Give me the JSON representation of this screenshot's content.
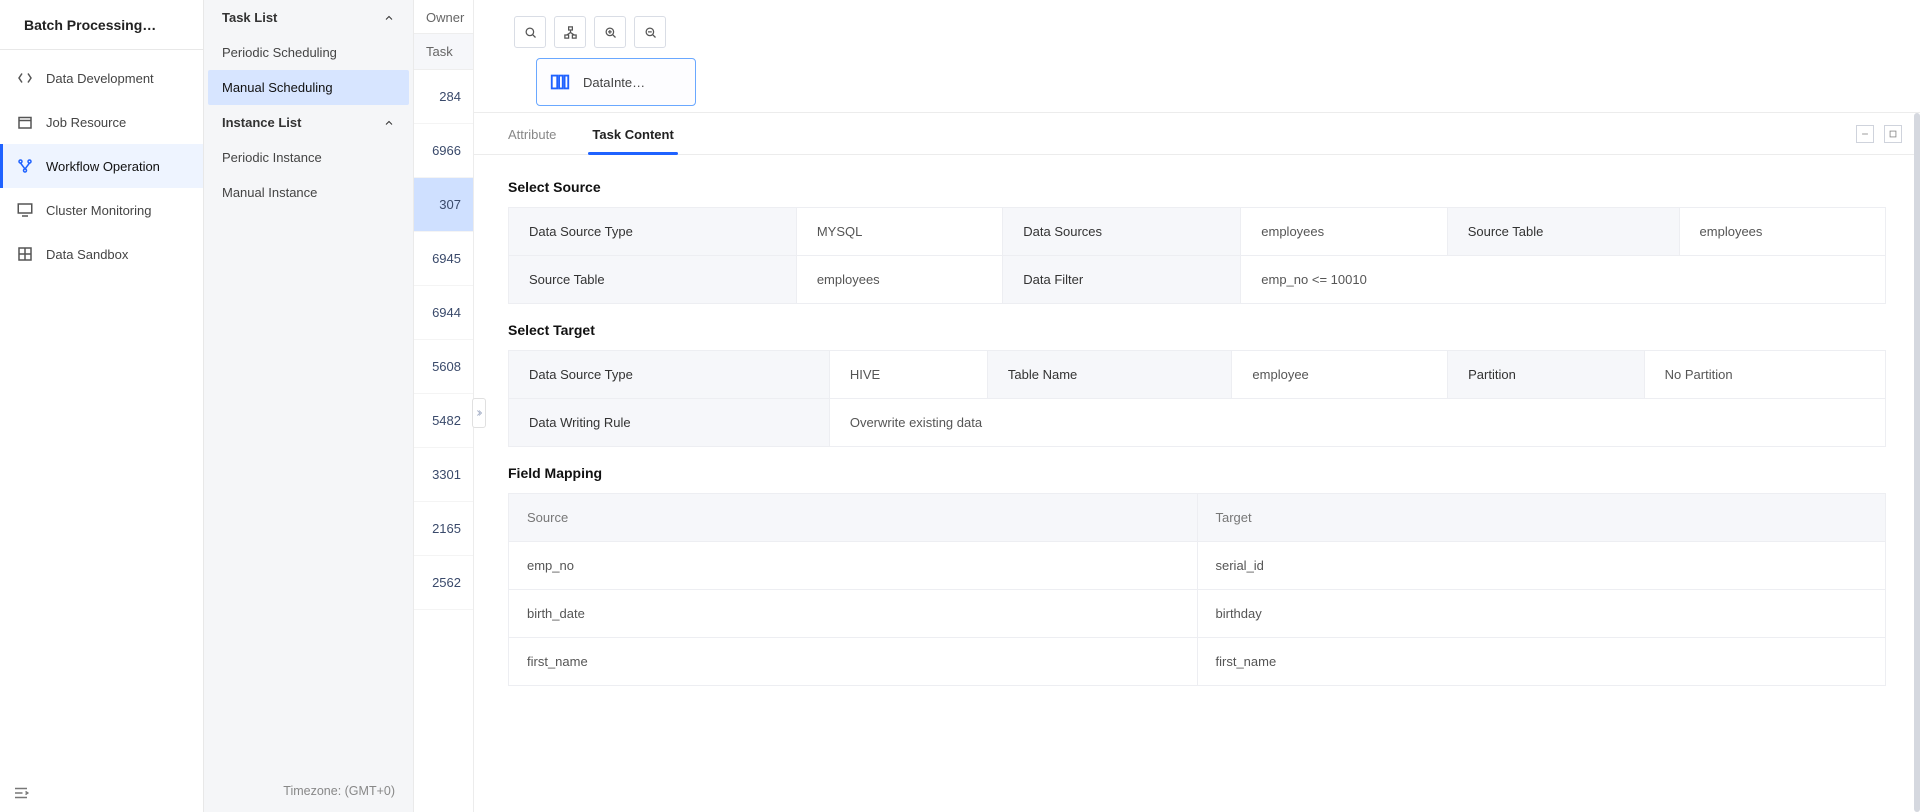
{
  "appTitle": "Batch Processing…",
  "sidebar1": {
    "items": [
      {
        "label": "Data Development",
        "icon": "code-brackets-icon"
      },
      {
        "label": "Job Resource",
        "icon": "package-icon"
      },
      {
        "label": "Workflow Operation",
        "icon": "workflow-icon"
      },
      {
        "label": "Cluster Monitoring",
        "icon": "monitor-icon"
      },
      {
        "label": "Data Sandbox",
        "icon": "sandbox-icon"
      }
    ],
    "activeIndex": 2
  },
  "sidebar2": {
    "groups": [
      {
        "title": "Task List",
        "expanded": true,
        "items": [
          {
            "label": "Periodic Scheduling"
          },
          {
            "label": "Manual Scheduling"
          }
        ],
        "activeItemIndex": 1
      },
      {
        "title": "Instance List",
        "expanded": true,
        "items": [
          {
            "label": "Periodic Instance"
          },
          {
            "label": "Manual Instance"
          }
        ],
        "activeItemIndex": -1
      }
    ],
    "timezone": "Timezone: (GMT+0)"
  },
  "taskColumn": {
    "ownerLabel": "Owner",
    "taskLabel": "Task",
    "ids": [
      "284",
      "6966",
      "307",
      "6945",
      "6944",
      "5608",
      "5482",
      "3301",
      "2165",
      "2562"
    ],
    "activeIndex": 2
  },
  "canvas": {
    "toolbar": [
      {
        "name": "search-icon",
        "title": "Search"
      },
      {
        "name": "tree-view-icon",
        "title": "Structure"
      },
      {
        "name": "zoom-in-icon",
        "title": "Zoom in"
      },
      {
        "name": "zoom-out-icon",
        "title": "Zoom out"
      }
    ],
    "node": {
      "label": "DataInte…",
      "icon": "data-integration-icon"
    }
  },
  "detail": {
    "tabs": [
      {
        "label": "Attribute"
      },
      {
        "label": "Task Content"
      }
    ],
    "activeTab": 1,
    "sections": {
      "selectSourceTitle": "Select Source",
      "source": {
        "dataSourceTypeK": "Data Source Type",
        "dataSourceTypeV": "MYSQL",
        "dataSourcesK": "Data Sources",
        "dataSourcesV": "employees",
        "sourceTableK": "Source Table",
        "sourceTableV": "employees",
        "sourceTable2K": "Source Table",
        "sourceTable2V": "employees",
        "dataFilterK": "Data Filter",
        "dataFilterV": "emp_no <= 10010"
      },
      "selectTargetTitle": "Select Target",
      "target": {
        "dataSourceTypeK": "Data Source Type",
        "dataSourceTypeV": "HIVE",
        "tableNameK": "Table Name",
        "tableNameV": "employee",
        "partitionK": "Partition",
        "partitionV": "No Partition",
        "writeRuleK": "Data Writing Rule",
        "writeRuleV": "Overwrite existing data"
      },
      "fieldMappingTitle": "Field Mapping",
      "mapping": {
        "headSource": "Source",
        "headTarget": "Target",
        "rows": [
          {
            "s": "emp_no",
            "t": "serial_id"
          },
          {
            "s": "birth_date",
            "t": "birthday"
          },
          {
            "s": "first_name",
            "t": "first_name"
          }
        ]
      }
    }
  }
}
